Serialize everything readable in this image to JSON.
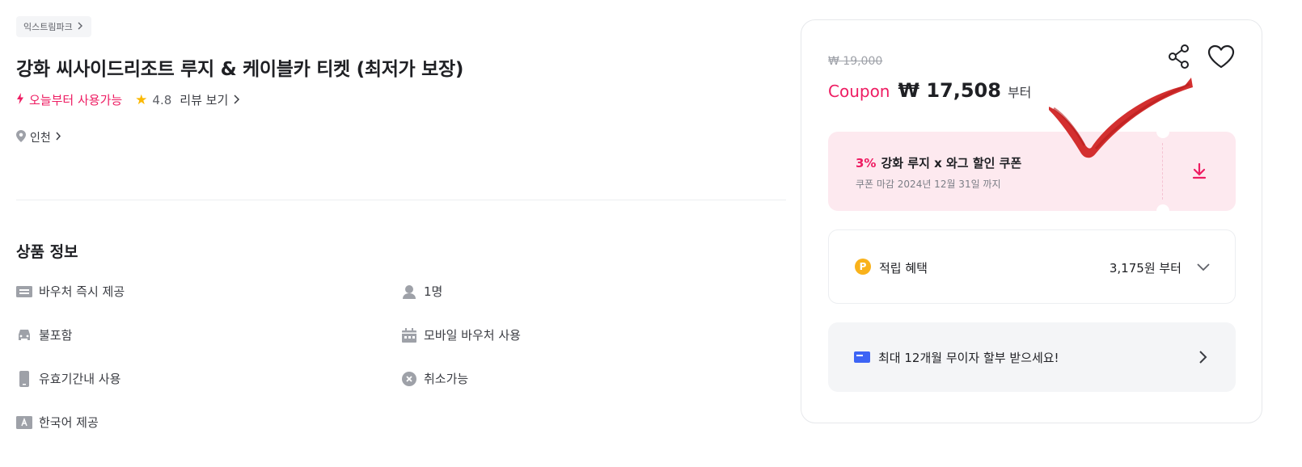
{
  "breadcrumb": {
    "label": "익스트림파크",
    "icon": "chevron-right-icon"
  },
  "product": {
    "title": "강화 씨사이드리조트 루지 & 케이블카 티켓 (최저가 보장)",
    "availability": "오늘부터 사용가능",
    "rating": "4.8",
    "review_label": "리뷰 보기",
    "location": "인천"
  },
  "section": {
    "title": "상품 정보",
    "items": [
      {
        "label": "바우처 즉시 제공",
        "icon": "ticket-icon"
      },
      {
        "label": "1명",
        "icon": "person-icon"
      },
      {
        "label": "불포함",
        "icon": "car-icon"
      },
      {
        "label": "모바일 바우처 사용",
        "icon": "calendar-icon"
      },
      {
        "label": "유효기간내 사용",
        "icon": "phone-icon"
      },
      {
        "label": "취소가능",
        "icon": "cancel-circle-icon"
      },
      {
        "label": "한국어 제공",
        "icon": "language-icon"
      }
    ]
  },
  "price_card": {
    "original_price": "₩ 19,000",
    "coupon_word": "Coupon",
    "price": "₩ 17,508",
    "price_suffix": "부터",
    "coupon": {
      "percent": "3%",
      "title": "강화 루지 x 와그 할인 쿠폰",
      "subtitle": "쿠폰 마감 2024년 12월 31일 까지"
    },
    "points": {
      "badge": "P",
      "label": "적립 혜택",
      "value": "3,175원 부터"
    },
    "installment": {
      "label": "최대 12개월 무이자 할부 받으세요!"
    }
  },
  "colors": {
    "accent": "#ee1c62",
    "star": "#fbb800",
    "points_badge": "#f9b21b",
    "card_icon": "#3d64f5",
    "checkmark": "#d32f2f"
  }
}
